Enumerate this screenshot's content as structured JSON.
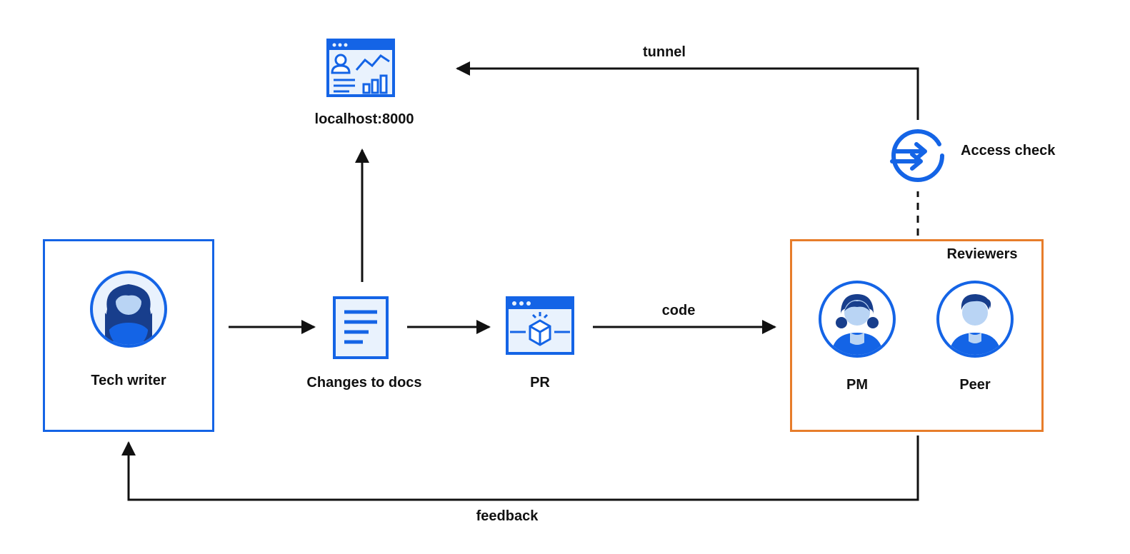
{
  "nodes": {
    "techWriter": "Tech writer",
    "changes": "Changes to docs",
    "pr": "PR",
    "localhost": "localhost:8000",
    "reviewers": "Reviewers",
    "pm": "PM",
    "peer": "Peer",
    "accessCheck": "Access check"
  },
  "edges": {
    "tunnel": "tunnel",
    "code": "code",
    "feedback": "feedback"
  },
  "colors": {
    "blue": "#1464e6",
    "darkBlue": "#183e8c",
    "lightBlue": "#e9f2fd",
    "orange": "#e77d2b",
    "black": "#111"
  }
}
